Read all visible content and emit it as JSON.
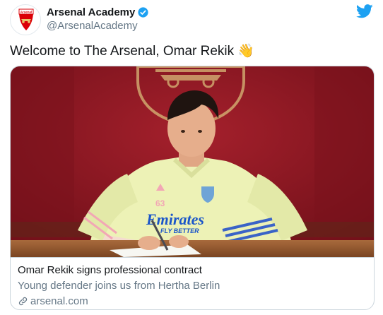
{
  "account": {
    "display_name": "Arsenal Academy",
    "handle": "@ArsenalAcademy",
    "verified": true,
    "avatar_text": "Arsenal"
  },
  "tweet": {
    "text": "Welcome to The Arsenal, Omar Rekik",
    "emoji": "👋"
  },
  "card": {
    "title": "Omar Rekik signs professional contract",
    "description": "Young defender joins us from Hertha Berlin",
    "domain": "arsenal.com",
    "shirt_sponsor": "Emirates",
    "shirt_sponsor_sub": "FLY BETTER",
    "shirt_number": "63"
  },
  "colors": {
    "twitter_blue": "#1da1f2",
    "arsenal_red": "#db0007",
    "wall_red": "#8d1420",
    "shirt_yellow": "#edf2b6"
  },
  "icons": [
    "verified-badge-icon",
    "twitter-bird-icon",
    "link-icon",
    "waving-hand-icon"
  ]
}
